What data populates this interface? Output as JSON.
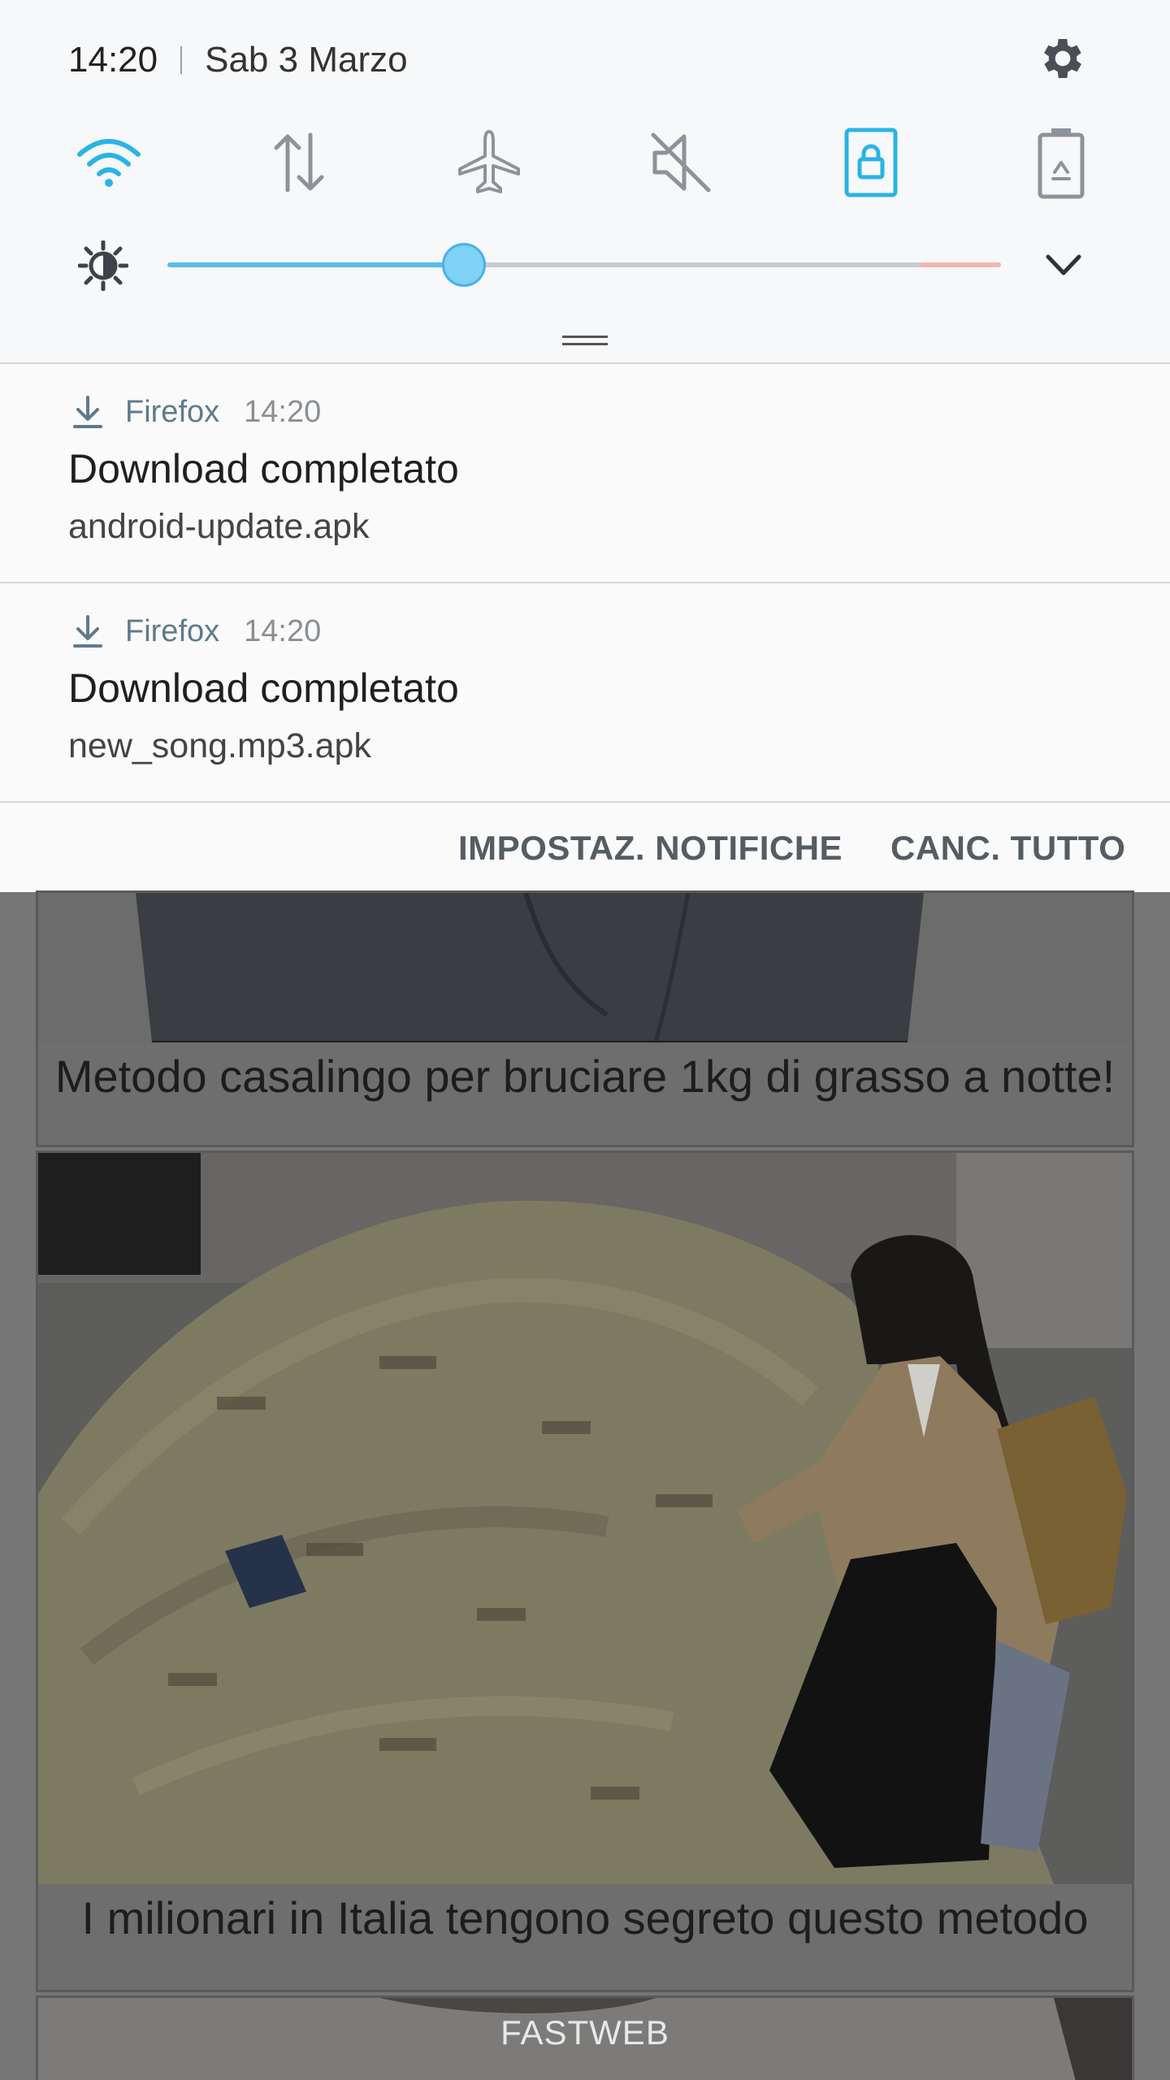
{
  "status": {
    "time": "14:20",
    "date": "Sab 3 Marzo"
  },
  "quick_toggles": [
    {
      "name": "wifi-icon",
      "active": true
    },
    {
      "name": "mobile-data-icon",
      "active": false
    },
    {
      "name": "airplane-mode-icon",
      "active": false
    },
    {
      "name": "sound-off-icon",
      "active": false
    },
    {
      "name": "screen-lock-icon",
      "active": true
    },
    {
      "name": "power-saving-icon",
      "active": false
    }
  ],
  "brightness": {
    "level": 0.356,
    "accent": "#58bde8"
  },
  "notifications": [
    {
      "app": "Firefox",
      "time": "14:20",
      "title": "Download completato",
      "body": "android-update.apk"
    },
    {
      "app": "Firefox",
      "time": "14:20",
      "title": "Download completato",
      "body": "new_song.mp3.apk"
    }
  ],
  "actions": {
    "settings_label": "IMPOSTAZ. NOTIFICHE",
    "clear_label": "CANC. TUTTO"
  },
  "webpage": {
    "card1_caption": "Metodo casalingo per bruciare 1kg di grasso a notte!",
    "card2_caption": "I milionari in Italia tengono segreto questo metodo",
    "footer": "FASTWEB"
  }
}
